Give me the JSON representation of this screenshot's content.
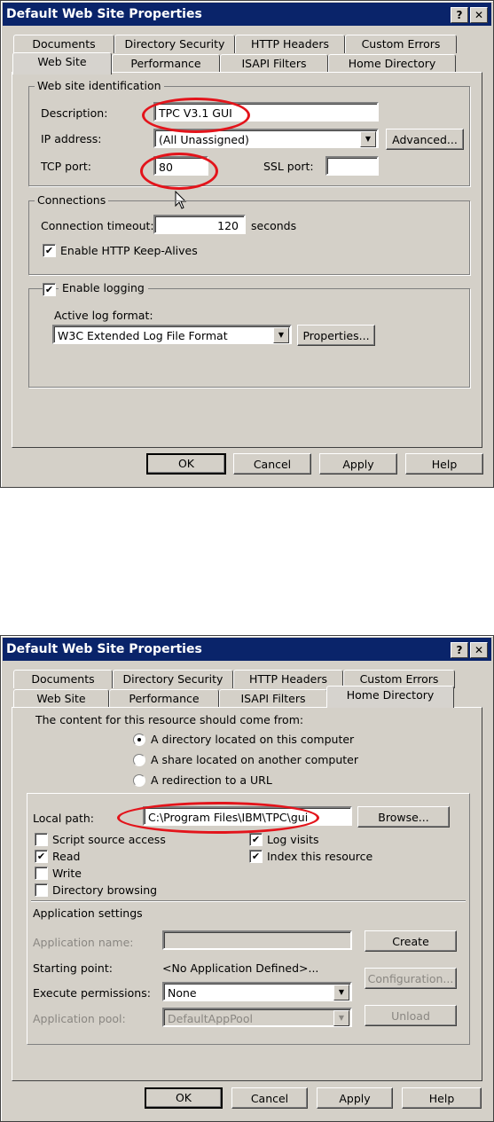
{
  "dialog1": {
    "title": "Default Web Site Properties",
    "title_buttons": {
      "help": "?",
      "close": "✕"
    },
    "tabs_row1": [
      "Documents",
      "Directory Security",
      "HTTP Headers",
      "Custom Errors"
    ],
    "tabs_row2": [
      "Web Site",
      "Performance",
      "ISAPI Filters",
      "Home Directory"
    ],
    "active_tab": "Web Site",
    "identification": {
      "group_title": "Web site identification",
      "description_label": "Description:",
      "description_value": "TPC V3.1 GUI",
      "ip_label": "IP address:",
      "ip_value": "(All Unassigned)",
      "advanced_button": "Advanced...",
      "tcp_label": "TCP port:",
      "tcp_value": "80",
      "ssl_label": "SSL port:",
      "ssl_value": ""
    },
    "connections": {
      "group_title": "Connections",
      "timeout_label": "Connection timeout:",
      "timeout_value": "120",
      "timeout_unit": "seconds",
      "keepalive_label": "Enable HTTP Keep-Alives",
      "keepalive_checked": true
    },
    "logging": {
      "enable_label": "Enable logging",
      "enable_checked": true,
      "format_label": "Active log format:",
      "format_value": "W3C Extended Log File Format",
      "properties_button": "Properties..."
    },
    "buttons": {
      "ok": "OK",
      "cancel": "Cancel",
      "apply": "Apply",
      "help": "Help"
    },
    "highlight_color": "#e3141b"
  },
  "dialog2": {
    "title": "Default Web Site Properties",
    "title_buttons": {
      "help": "?",
      "close": "✕"
    },
    "tabs_row1": [
      "Documents",
      "Directory Security",
      "HTTP Headers",
      "Custom Errors"
    ],
    "tabs_row2": [
      "Web Site",
      "Performance",
      "ISAPI Filters",
      "Home Directory"
    ],
    "active_tab": "Home Directory",
    "content_source": {
      "prompt": "The content for this resource should come from:",
      "options": [
        {
          "label": "A directory located on this computer",
          "selected": true
        },
        {
          "label": "A share located on another computer",
          "selected": false
        },
        {
          "label": "A redirection to a URL",
          "selected": false
        }
      ]
    },
    "local_path_label": "Local path:",
    "local_path_value": "C:\\Program Files\\IBM\\TPC\\gui",
    "browse_button": "Browse...",
    "checkboxes_left": [
      {
        "label": "Script source access",
        "checked": false
      },
      {
        "label": "Read",
        "checked": true
      },
      {
        "label": "Write",
        "checked": false
      },
      {
        "label": "Directory browsing",
        "checked": false
      }
    ],
    "checkboxes_right": [
      {
        "label": "Log visits",
        "checked": true
      },
      {
        "label": "Index this resource",
        "checked": true
      }
    ],
    "app_settings": {
      "title": "Application settings",
      "app_name_label": "Application name:",
      "app_name_value": "",
      "create_button": "Create",
      "starting_point_label": "Starting point:",
      "starting_point_value": "<No Application Defined>...",
      "configuration_button": "Configuration...",
      "exec_perm_label": "Execute permissions:",
      "exec_perm_value": "None",
      "app_pool_label": "Application pool:",
      "app_pool_value": "DefaultAppPool",
      "unload_button": "Unload"
    },
    "buttons": {
      "ok": "OK",
      "cancel": "Cancel",
      "apply": "Apply",
      "help": "Help"
    }
  }
}
